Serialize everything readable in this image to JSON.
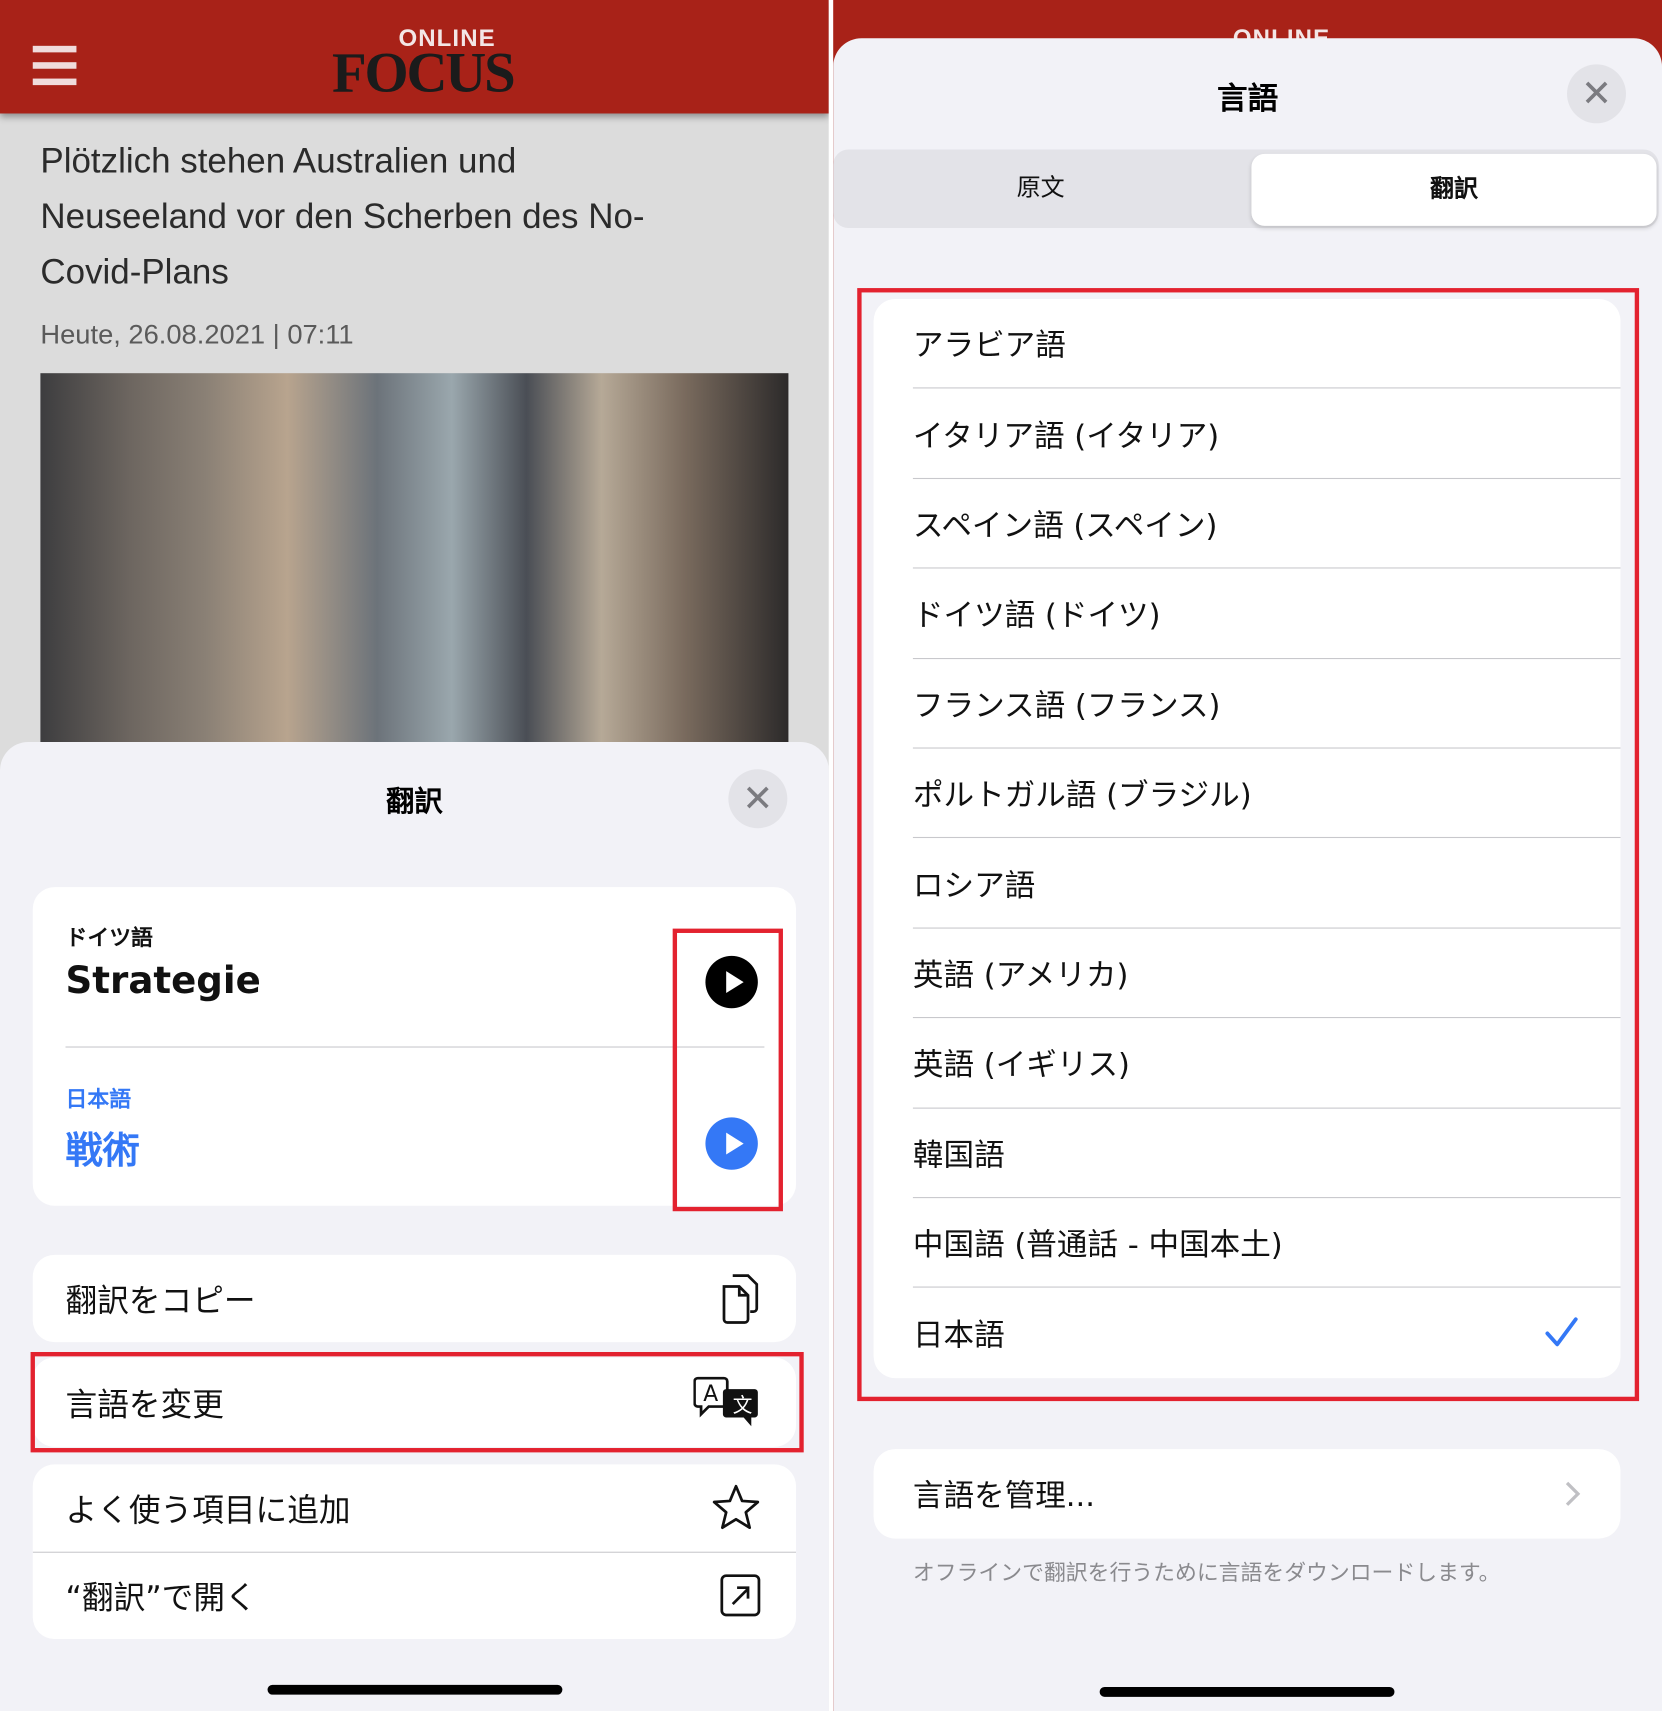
{
  "left": {
    "header": {
      "logo_top": "ONLINE",
      "logo_main": "FOCUS"
    },
    "article": {
      "title_lines": [
        "Plötzlich stehen Australien und",
        "Neuseeland vor den Scherben des No-",
        "Covid-Plans"
      ],
      "date": "Heute, 26.08.2021 | 07:11"
    },
    "sheet": {
      "title": "翻訳",
      "source": {
        "language": "ドイツ語",
        "text": "Strategie"
      },
      "target": {
        "language": "日本語",
        "text": "戦術"
      },
      "menu": [
        {
          "label": "翻訳をコピー",
          "icon": "copy-icon"
        },
        {
          "label": "言語を変更",
          "icon": "translate-icon"
        },
        {
          "label": "よく使う項目に追加",
          "icon": "star-icon"
        },
        {
          "label": "“翻訳”で開く",
          "icon": "open-external-icon"
        }
      ]
    }
  },
  "right": {
    "sheet": {
      "title": "言語",
      "segments": [
        "原文",
        "翻訳"
      ],
      "selected_segment": "翻訳",
      "languages": [
        "アラビア語",
        "イタリア語 (イタリア)",
        "スペイン語 (スペイン)",
        "ドイツ語 (ドイツ)",
        "フランス語 (フランス)",
        "ポルトガル語 (ブラジル)",
        "ロシア語",
        "英語 (アメリカ)",
        "英語 (イギリス)",
        "韓国語",
        "中国語 (普通話 - 中国本土)",
        "日本語"
      ],
      "selected_language": "日本語",
      "manage_label": "言語を管理...",
      "footnote": "オフラインで翻訳を行うために言語をダウンロードします。"
    }
  },
  "colors": {
    "brand_red": "#a82218",
    "accent_blue": "#3478f6",
    "highlight_red": "#e3222f",
    "sheet_bg": "#f2f2f7"
  }
}
